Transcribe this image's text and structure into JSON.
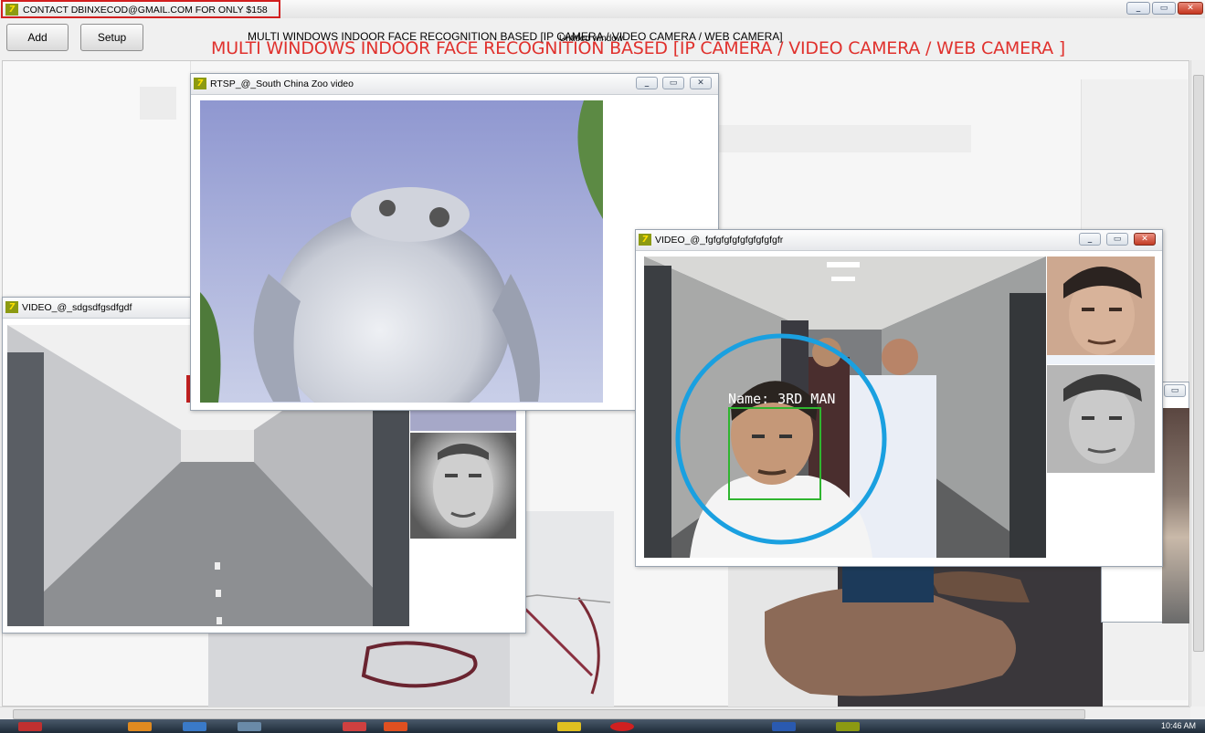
{
  "window": {
    "title": "CONTACT DBINXECOD@GMAIL.COM FOR ONLY $158",
    "app_icon": "app-logo-icon",
    "controls": [
      "minimize-icon",
      "maximize-icon",
      "close-icon"
    ]
  },
  "toolbar": {
    "add_label": "Add",
    "setup_label": "Setup"
  },
  "headline": {
    "small_title": "MULTI WINDOWS INDOOR FACE RECOGNITION BASED [IP CAMERA / VIDEO CAMERA / WEB CAMERA]",
    "overlap_title": "Untitled window",
    "red_banner": "MULTI WINDOWS INDOOR FACE RECOGNITION BASED [IP CAMERA / VIDEO CAMERA / WEB CAMERA ]",
    "banner_color": "#e0312d"
  },
  "windows": {
    "rtsp": {
      "title": "RTSP_@_South China Zoo video"
    },
    "video_left": {
      "title": "VIDEO_@_sdgsdfgsdfgdf"
    },
    "video_right": {
      "title": "VIDEO_@_fgfgfgfgfgfgfgfgfgfr",
      "detection_label": "Name: 3RD MAN",
      "box_color": "#2fb52f",
      "circle_color": "#1aa0e0"
    }
  },
  "taskbar": {
    "clock": "10:46 AM"
  }
}
